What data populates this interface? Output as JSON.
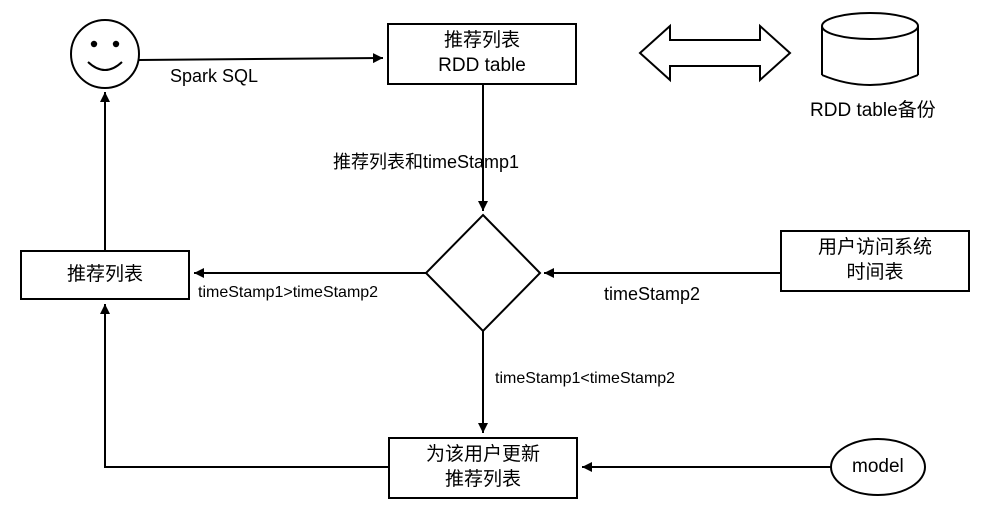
{
  "nodes": {
    "user_icon": "smiley",
    "rdd_box_line1": "推荐列表",
    "rdd_box_line2": "RDD table",
    "backup_label": "RDD table备份",
    "rec_list_left": "推荐列表",
    "schedule_box_line1": "用户访问系统",
    "schedule_box_line2": "时间表",
    "update_box_line1": "为该用户更新",
    "update_box_line2": "推荐列表",
    "model_label": "model"
  },
  "edges": {
    "spark_sql": "Spark SQL",
    "list_and_ts1": "推荐列表和timeStamp1",
    "ts2": "timeStamp2",
    "cond_gt": "timeStamp1>timeStamp2",
    "cond_lt": "timeStamp1<timeStamp2"
  },
  "chart_data": {
    "type": "flowchart",
    "nodes": [
      {
        "id": "user",
        "type": "smiley",
        "label": ""
      },
      {
        "id": "rdd",
        "type": "process",
        "label": "推荐列表 RDD table"
      },
      {
        "id": "backup",
        "type": "datastore",
        "label": "RDD table备份"
      },
      {
        "id": "reclist",
        "type": "process",
        "label": "推荐列表"
      },
      {
        "id": "decision",
        "type": "decision",
        "label": ""
      },
      {
        "id": "schedule",
        "type": "process",
        "label": "用户访问系统 时间表"
      },
      {
        "id": "update",
        "type": "process",
        "label": "为该用户更新 推荐列表"
      },
      {
        "id": "model",
        "type": "terminator",
        "label": "model"
      }
    ],
    "edges": [
      {
        "from": "user",
        "to": "rdd",
        "label": "Spark SQL"
      },
      {
        "from": "rdd",
        "to": "backup",
        "label": "",
        "bidirectional": true
      },
      {
        "from": "rdd",
        "to": "decision",
        "label": "推荐列表和timeStamp1"
      },
      {
        "from": "schedule",
        "to": "decision",
        "label": "timeStamp2"
      },
      {
        "from": "decision",
        "to": "reclist",
        "label": "timeStamp1>timeStamp2"
      },
      {
        "from": "decision",
        "to": "update",
        "label": "timeStamp1<timeStamp2"
      },
      {
        "from": "model",
        "to": "update",
        "label": ""
      },
      {
        "from": "update",
        "to": "reclist",
        "label": ""
      },
      {
        "from": "reclist",
        "to": "user",
        "label": ""
      }
    ]
  }
}
